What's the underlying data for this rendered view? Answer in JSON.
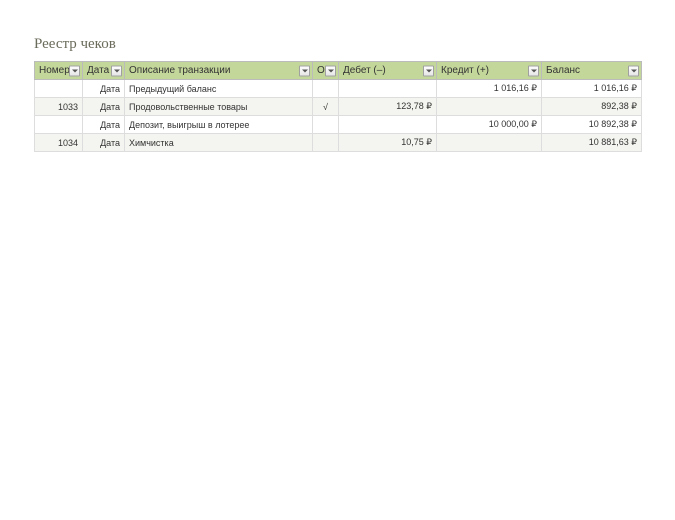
{
  "title": "Реестр чеков",
  "columns": [
    {
      "key": "num",
      "label": "Номер"
    },
    {
      "key": "date",
      "label": "Дата"
    },
    {
      "key": "desc",
      "label": "Описание транзакции"
    },
    {
      "key": "o",
      "label": "О"
    },
    {
      "key": "debit",
      "label": "Дебет (–)"
    },
    {
      "key": "credit",
      "label": "Кредит (+)"
    },
    {
      "key": "balance",
      "label": "Баланс"
    }
  ],
  "rows": [
    {
      "num": "",
      "date": "Дата",
      "desc": "Предыдущий баланс",
      "o": "",
      "debit": "",
      "credit": "1 016,16 ₽",
      "balance": "1 016,16 ₽"
    },
    {
      "num": "1033",
      "date": "Дата",
      "desc": "Продовольственные товары",
      "o": "√",
      "debit": "123,78 ₽",
      "credit": "",
      "balance": "892,38 ₽"
    },
    {
      "num": "",
      "date": "Дата",
      "desc": "Депозит, выигрыш в лотерее",
      "o": "",
      "debit": "",
      "credit": "10 000,00 ₽",
      "balance": "10 892,38 ₽"
    },
    {
      "num": "1034",
      "date": "Дата",
      "desc": "Химчистка",
      "o": "",
      "debit": "10,75 ₽",
      "credit": "",
      "balance": "10 881,63 ₽"
    }
  ]
}
